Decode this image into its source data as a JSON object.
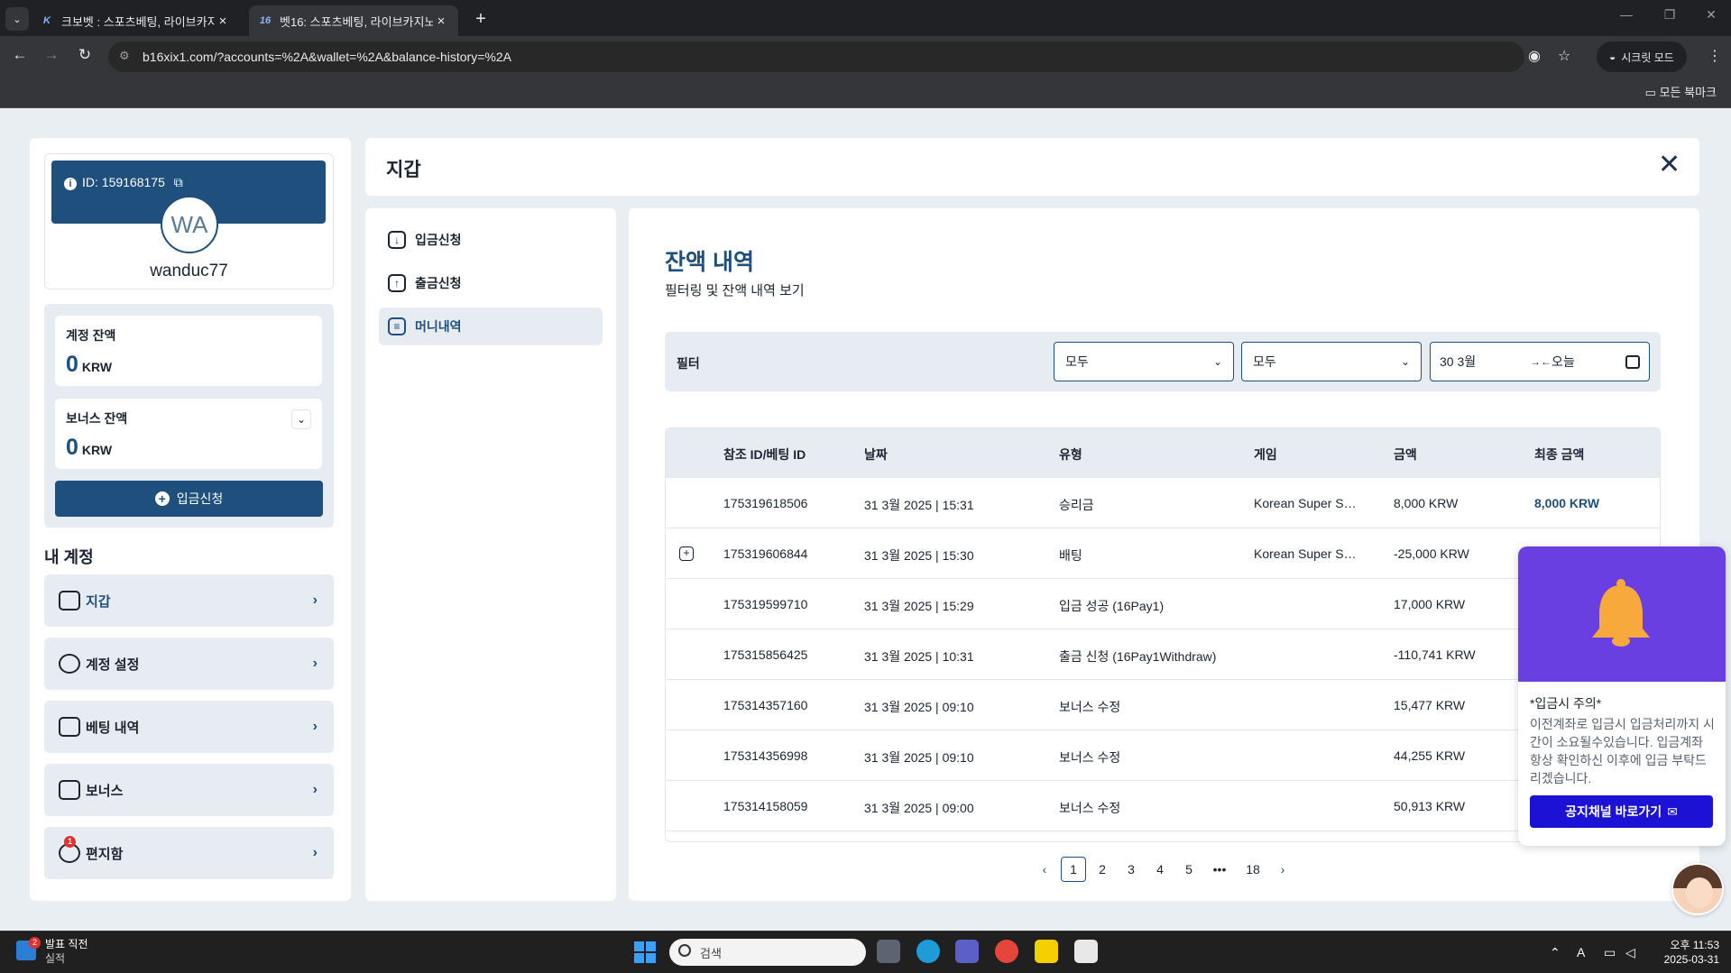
{
  "browser": {
    "tabs": [
      {
        "favicon": "K",
        "title": "크보벳 : 스포츠베팅, 라이브카지노"
      },
      {
        "favicon": "16",
        "title": "벳16: 스포츠베팅, 라이브카지노"
      }
    ],
    "url": "b16xix1.com/?accounts=%2A&wallet=%2A&balance-history=%2A",
    "incognito_label": "시크릿 모드",
    "all_bookmarks": "모든 북마크"
  },
  "profile": {
    "id_label": "ID: 159168175",
    "initials": "WA",
    "username": "wanduc77"
  },
  "balances": {
    "account_label": "계정 잔액",
    "account_value": "0",
    "bonus_label": "보너스 잔액",
    "bonus_value": "0",
    "currency": "KRW",
    "deposit_button": "입금신청"
  },
  "my_account": {
    "title": "내 계정",
    "items": [
      {
        "label": "지갑",
        "icon": "wallet-icon"
      },
      {
        "label": "계정 설정",
        "icon": "user-settings-icon"
      },
      {
        "label": "베팅 내역",
        "icon": "receipt-icon"
      },
      {
        "label": "보너스",
        "icon": "gift-icon"
      },
      {
        "label": "편지함",
        "icon": "message-icon",
        "badge": "1"
      }
    ]
  },
  "wallet": {
    "title": "지갑",
    "submenu": [
      {
        "label": "입금신청",
        "icon": "download-icon"
      },
      {
        "label": "출금신청",
        "icon": "upload-icon"
      },
      {
        "label": "머니내역",
        "icon": "document-icon"
      }
    ]
  },
  "history": {
    "title": "잔액 내역",
    "subtitle": "필터링 및 잔액 내역 보기",
    "filter_label": "필터",
    "select1": "모두",
    "select2": "모두",
    "date_from": "30 3월",
    "date_to": "오늘",
    "columns": [
      "참조 ID/베팅 ID",
      "날짜",
      "유형",
      "게임",
      "금액",
      "최종 금액"
    ],
    "rows": [
      {
        "ref": "175319618506",
        "date": "31 3월 2025 | 15:31",
        "type": "승리금",
        "game": "Korean Super S…",
        "amount": "8,000 KRW",
        "final": "8,000 KRW",
        "expand": false
      },
      {
        "ref": "175319606844",
        "date": "31 3월 2025 | 15:30",
        "type": "배팅",
        "game": "Korean Super S…",
        "amount": "-25,000 KRW",
        "final": "",
        "expand": true
      },
      {
        "ref": "175319599710",
        "date": "31 3월 2025 | 15:29",
        "type": "입금 성공 (16Pay1)",
        "game": "",
        "amount": "17,000 KRW",
        "final": "",
        "expand": false
      },
      {
        "ref": "175315856425",
        "date": "31 3월 2025 | 10:31",
        "type": "출금 신청 (16Pay1Withdraw)",
        "game": "",
        "amount": "-110,741 KRW",
        "final": "",
        "expand": false
      },
      {
        "ref": "175314357160",
        "date": "31 3월 2025 | 09:10",
        "type": "보너스 수정",
        "game": "",
        "amount": "15,477 KRW",
        "final": "",
        "expand": false
      },
      {
        "ref": "175314356998",
        "date": "31 3월 2025 | 09:10",
        "type": "보너스 수정",
        "game": "",
        "amount": "44,255 KRW",
        "final": "",
        "expand": false
      },
      {
        "ref": "175314158059",
        "date": "31 3월 2025 | 09:00",
        "type": "보너스 수정",
        "game": "",
        "amount": "50,913 KRW",
        "final": "",
        "expand": false
      }
    ],
    "pagination": {
      "pages": [
        "1",
        "2",
        "3",
        "4",
        "5"
      ],
      "ellipsis": "•••",
      "last": "18",
      "current": "1"
    }
  },
  "notice": {
    "title": "*입금시 주의*",
    "text": "이전계좌로 입금시 입금처리까지 시간이 소요될수있습니다. 입금계좌 항상 확인하신 이후에 입금 부탁드리겠습니다.",
    "button": "공지채널 바로가기"
  },
  "taskbar": {
    "news_title": "발표 직전",
    "news_sub": "실적",
    "news_badge": "2",
    "search_placeholder": "검색",
    "time": "오후 11:53",
    "date": "2025-03-31"
  },
  "colors": {
    "primary": "#1e4f7d",
    "panel": "#e6ecf2",
    "notice": "#6a3fe2",
    "notice_button": "#1b12d6"
  }
}
